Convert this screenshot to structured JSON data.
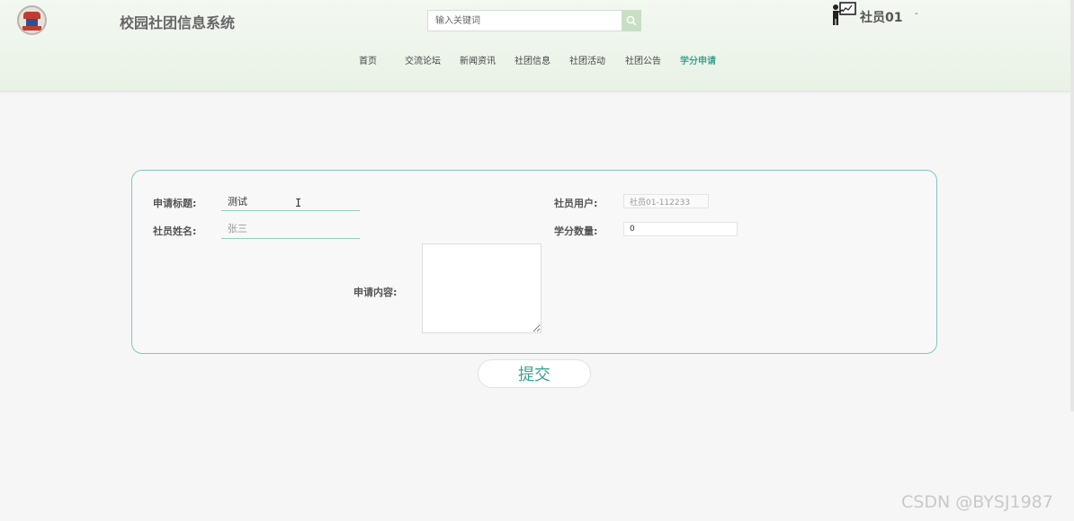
{
  "header": {
    "site_title": "校园社团信息系统",
    "search_placeholder": "输入关键词",
    "user_name": "社员01",
    "user_caret": "-"
  },
  "nav": {
    "items": [
      "首页",
      "交流论坛",
      "新闻资讯",
      "社团信息",
      "社团活动",
      "社团公告",
      "学分申请"
    ],
    "active_index": 6
  },
  "form": {
    "title_label": "申请标题:",
    "title_value": "测试",
    "name_label": "社员姓名:",
    "name_placeholder": "张三",
    "user_label": "社员用户:",
    "user_value": "社员01-112233",
    "credits_label": "学分数量:",
    "credits_value": "0",
    "content_label": "申请内容:",
    "content_value": ""
  },
  "submit_label": "提交",
  "watermark": "CSDN @BYSJ1987",
  "colors": {
    "accent": "#3aa38f",
    "header_bg": "#eef5ec",
    "card_border": "#7fc7bd"
  },
  "icons": {
    "search": "search-icon",
    "user": "teacher-board-icon",
    "logo": "school-logo"
  }
}
